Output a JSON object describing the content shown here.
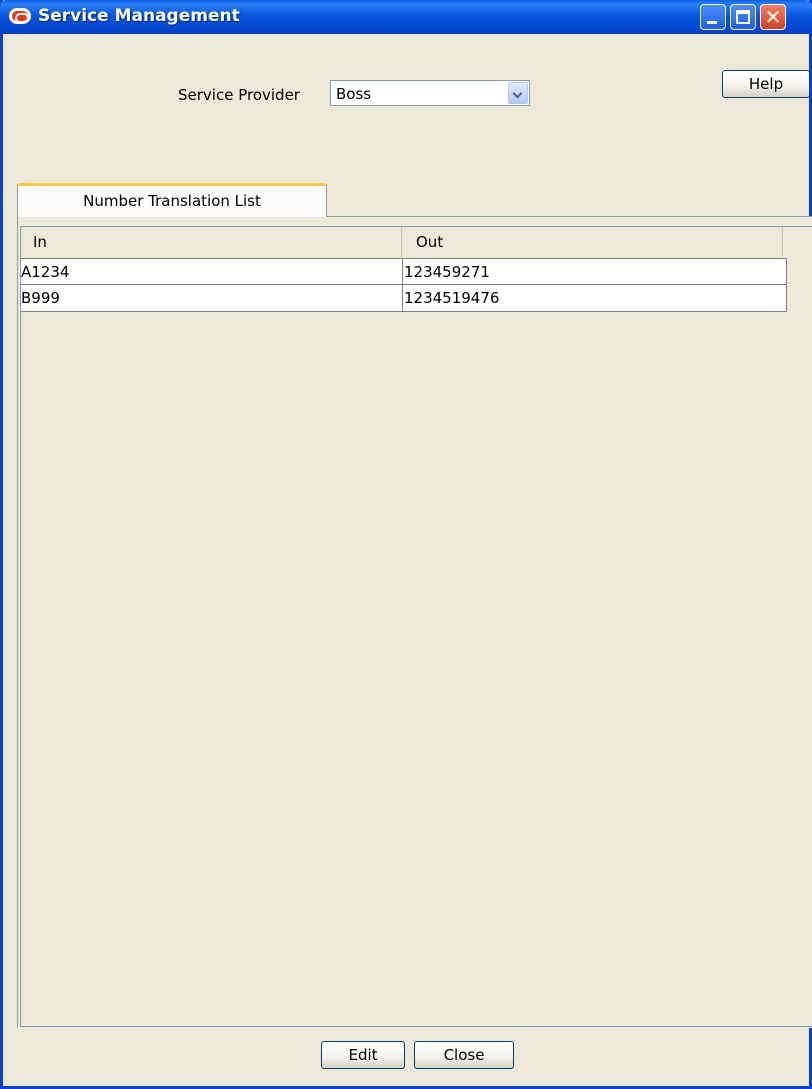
{
  "window": {
    "title": "Service Management"
  },
  "header": {
    "service_provider_label": "Service Provider",
    "service_provider_value": "Boss",
    "help_label": "Help"
  },
  "tabs": [
    {
      "label": "Number Translation List",
      "selected": true
    }
  ],
  "table": {
    "columns": [
      "In",
      "Out"
    ],
    "rows": [
      {
        "in": "A1234",
        "out": "123459271"
      },
      {
        "in": "B999",
        "out": "1234519476"
      }
    ]
  },
  "footer": {
    "edit_label": "Edit",
    "close_label": "Close"
  },
  "colors": {
    "titlebar": "#0054E3",
    "tab_highlight": "#FFC83C",
    "window_bg": "#ECE9D8"
  },
  "icons": {
    "app": "oracle-logo-icon",
    "minimize": "minimize-icon",
    "maximize": "maximize-icon",
    "close": "close-icon",
    "dropdown": "chevron-down-icon"
  }
}
